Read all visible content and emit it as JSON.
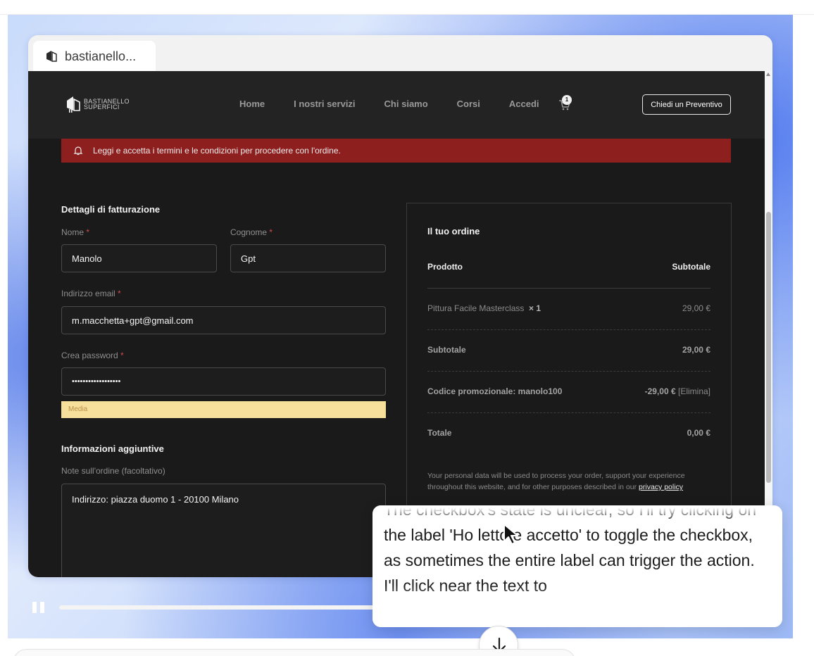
{
  "tab": {
    "title": "bastianello..."
  },
  "site": {
    "logo_text_1": "BASTIANELLO",
    "logo_text_2": "SUPERFICI",
    "nav": [
      "Home",
      "I nostri servizi",
      "Chi siamo",
      "Corsi",
      "Accedi"
    ],
    "cart_count": "1",
    "cta": "Chiedi un Preventivo"
  },
  "alert": {
    "text": "Leggi e accetta i termini e le condizioni per procedere con l'ordine."
  },
  "billing": {
    "title": "Dettagli di fatturazione",
    "required_mark": "*",
    "first_name_label": "Nome",
    "first_name_value": "Manolo",
    "last_name_label": "Cognome",
    "last_name_value": "Gpt",
    "email_label": "Indirizzo email",
    "email_value": "m.macchetta+gpt@gmail.com",
    "password_label": "Crea password",
    "password_value": "••••••••••••••••••",
    "strength": "Media"
  },
  "additional": {
    "title": "Informazioni aggiuntive",
    "notes_label": "Note sull'ordine (facoltativo)",
    "notes_value": "Indirizzo: piazza duomo 1 - 20100 Milano"
  },
  "order": {
    "title": "Il tuo ordine",
    "col_product": "Prodotto",
    "col_subtotal": "Subtotale",
    "item_name": "Pittura Facile Masterclass",
    "item_qty": "× 1",
    "item_price": "29,00 €",
    "subtotal_label": "Subtotale",
    "subtotal_value": "29,00 €",
    "coupon_label": "Codice promozionale: manolo100",
    "coupon_value": "-29,00 €",
    "coupon_remove": "[Elimina]",
    "total_label": "Totale",
    "total_value": "0,00 €",
    "privacy_text": "Your personal data will be used to process your order, support your experience throughout this website, and for other purposes described in our",
    "privacy_link": "privacy policy"
  },
  "playback": {
    "progress": 0.575
  },
  "bubble": {
    "text": "The checkbox's state is unclear, so I'll try clicking on the label 'Ho letto e accetto' to toggle the checkbox, as sometimes the entire label can trigger the action. I'll click near the text to"
  },
  "colors": {
    "alert": "#8e1f1f",
    "strength_bg": "#f7df9c",
    "site_bg": "#1a1a1a"
  }
}
